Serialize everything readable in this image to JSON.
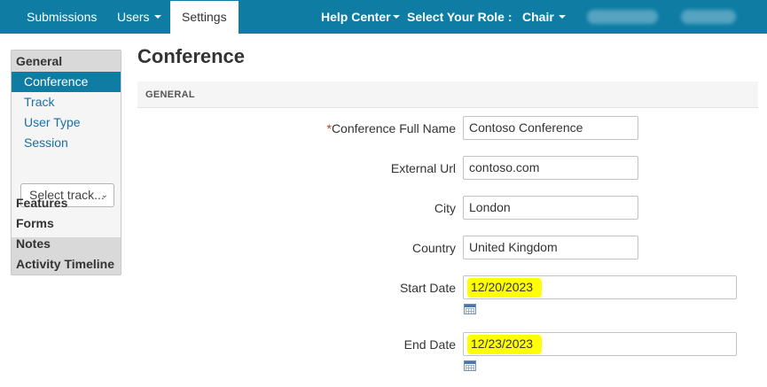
{
  "nav": {
    "submissions": "Submissions",
    "users": "Users",
    "settings": "Settings",
    "help_center": "Help Center",
    "select_role_label": "Select Your Role :",
    "role": "Chair"
  },
  "sidebar": {
    "general": "General",
    "links": [
      "Conference",
      "Track",
      "User Type",
      "Session"
    ],
    "select_track": "Select track...",
    "sections": [
      "Features",
      "Forms",
      "Notes",
      "Activity Timeline"
    ]
  },
  "main": {
    "title": "Conference",
    "panel_heading": "GENERAL",
    "fields": {
      "full_name": {
        "required_mark": "*",
        "label": "Conference Full Name",
        "value": "Contoso Conference"
      },
      "external_url": {
        "label": "External Url",
        "value": "contoso.com"
      },
      "city": {
        "label": "City",
        "value": "London"
      },
      "country": {
        "label": "Country",
        "value": "United Kingdom"
      },
      "start_date": {
        "label": "Start Date",
        "value": "12/20/2023"
      },
      "end_date": {
        "label": "End Date",
        "value": "12/23/2023"
      }
    }
  },
  "colors": {
    "nav_bg": "#0e7ca3",
    "highlight": "#ffff00",
    "link": "#1a6fa0"
  },
  "icons": [
    "calendar-icon",
    "caret-down-icon",
    "chevron-down-icon"
  ]
}
